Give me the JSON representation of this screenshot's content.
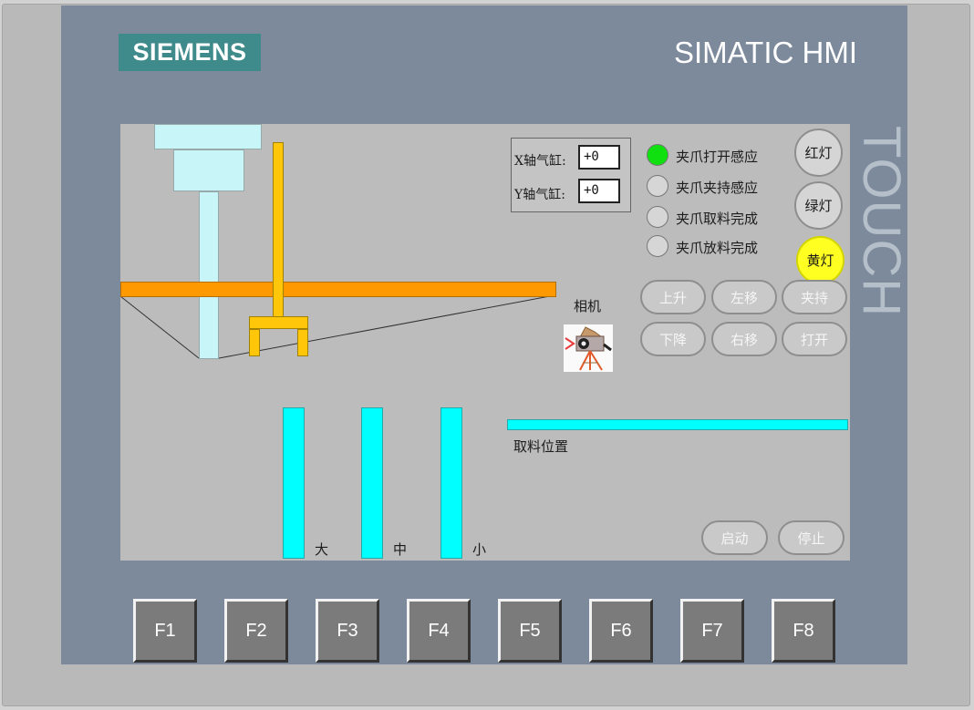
{
  "device": {
    "brand": "SIEMENS",
    "model": "SIMATIC HMI",
    "touch_label": "TOUCH"
  },
  "io_fields": {
    "x_cylinder_label": "X轴气缸:",
    "x_cylinder_value": "+0",
    "y_cylinder_label": "Y轴气缸:",
    "y_cylinder_value": "+0"
  },
  "indicators": [
    {
      "label": "夹爪打开感应",
      "color": "#10e010"
    },
    {
      "label": "夹爪夹持感应",
      "color": "#d6d6d6"
    },
    {
      "label": "夹爪取料完成",
      "color": "#d6d6d6"
    },
    {
      "label": "夹爪放料完成",
      "color": "#d6d6d6"
    }
  ],
  "lamps": {
    "red": {
      "label": "红灯",
      "color": "#d5d5d5"
    },
    "green": {
      "label": "绿灯",
      "color": "#d5d5d5"
    },
    "yellow": {
      "label": "黄灯",
      "color": "#ffff22"
    }
  },
  "camera_label": "相机",
  "motion_buttons": {
    "up": "上升",
    "left": "左移",
    "clamp": "夹持",
    "down": "下降",
    "right": "右移",
    "open": "打开"
  },
  "pick_position_label": "取料位置",
  "bin_labels": {
    "large": "大",
    "medium": "中",
    "small": "小"
  },
  "control_buttons": {
    "start": "启动",
    "stop": "停止"
  },
  "function_keys": [
    "F1",
    "F2",
    "F3",
    "F4",
    "F5",
    "F6",
    "F7",
    "F8"
  ],
  "colors": {
    "panel": "#7c8a9b",
    "screen": "#bcbcbc",
    "logo": "#3f8a8a",
    "beam": "#ff9900",
    "arm": "#ffc60a",
    "bin": "#00ffff"
  }
}
